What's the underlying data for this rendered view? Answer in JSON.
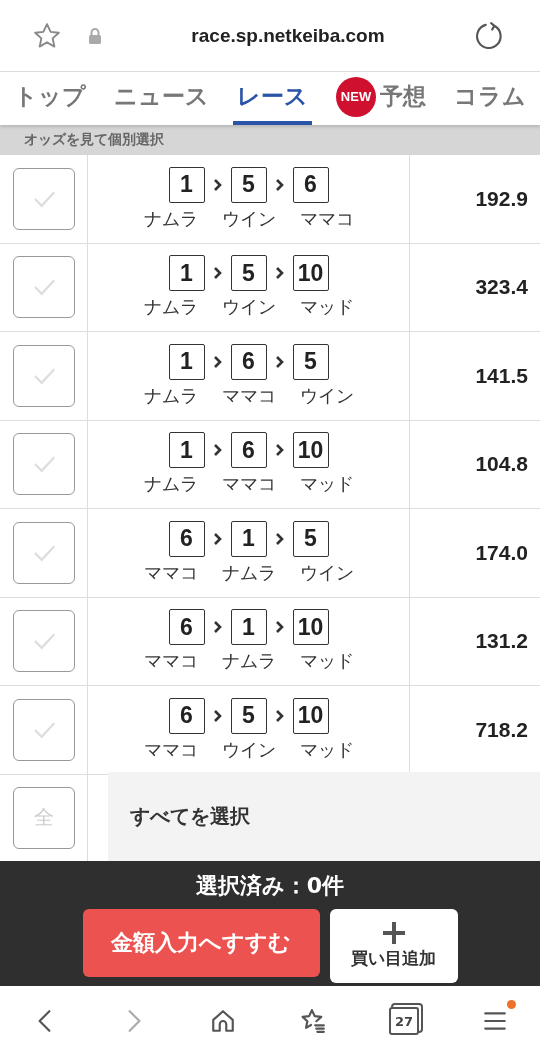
{
  "address_bar": {
    "url": "race.sp.netkeiba.com"
  },
  "tabs": [
    {
      "label": "トップ",
      "selected": false
    },
    {
      "label": "ニュース",
      "selected": false
    },
    {
      "label": "レース",
      "selected": true
    },
    {
      "label": "予想",
      "selected": false,
      "badge": "NEW"
    },
    {
      "label": "コラム",
      "selected": false
    }
  ],
  "section_title": "オッズを見て個別選択",
  "rows": [
    {
      "checked": false,
      "horses": [
        {
          "number": "1",
          "name": "ナムラ"
        },
        {
          "number": "5",
          "name": "ウイン"
        },
        {
          "number": "6",
          "name": "ママコ"
        }
      ],
      "odds": "192.9"
    },
    {
      "checked": false,
      "horses": [
        {
          "number": "1",
          "name": "ナムラ"
        },
        {
          "number": "5",
          "name": "ウイン"
        },
        {
          "number": "10",
          "name": "マッド"
        }
      ],
      "odds": "323.4"
    },
    {
      "checked": false,
      "horses": [
        {
          "number": "1",
          "name": "ナムラ"
        },
        {
          "number": "6",
          "name": "ママコ"
        },
        {
          "number": "5",
          "name": "ウイン"
        }
      ],
      "odds": "141.5"
    },
    {
      "checked": false,
      "horses": [
        {
          "number": "1",
          "name": "ナムラ"
        },
        {
          "number": "6",
          "name": "ママコ"
        },
        {
          "number": "10",
          "name": "マッド"
        }
      ],
      "odds": "104.8"
    },
    {
      "checked": false,
      "horses": [
        {
          "number": "6",
          "name": "ママコ"
        },
        {
          "number": "1",
          "name": "ナムラ"
        },
        {
          "number": "5",
          "name": "ウイン"
        }
      ],
      "odds": "174.0"
    },
    {
      "checked": false,
      "horses": [
        {
          "number": "6",
          "name": "ママコ"
        },
        {
          "number": "1",
          "name": "ナムラ"
        },
        {
          "number": "10",
          "name": "マッド"
        }
      ],
      "odds": "131.2"
    },
    {
      "checked": false,
      "horses": [
        {
          "number": "6",
          "name": "ママコ"
        },
        {
          "number": "5",
          "name": "ウイン"
        },
        {
          "number": "10",
          "name": "マッド"
        }
      ],
      "odds": "718.2"
    }
  ],
  "select_all": {
    "icon_label": "全",
    "label": "すべてを選択",
    "checked": false
  },
  "bottom_bar": {
    "status": "選択済み：0件",
    "primary_button": "金額入力へすすむ",
    "add_button": "買い目追加"
  },
  "nav_bar": {
    "tab_count": "27",
    "menu_notification": true
  }
}
